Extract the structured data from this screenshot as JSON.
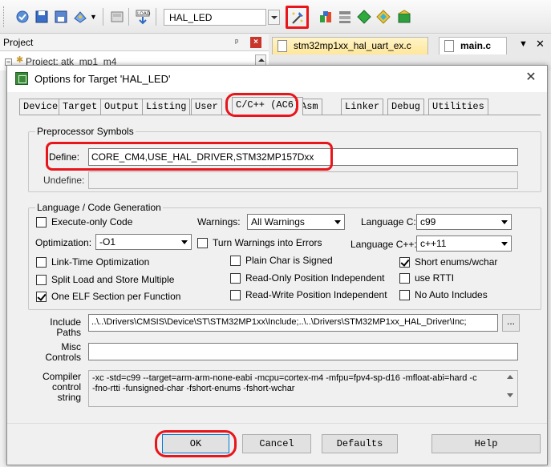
{
  "toolbar": {
    "target_name": "HAL_LED",
    "icons": [
      "build-icon",
      "save-all-icon",
      "copy-icon",
      "batch-build-icon",
      "dropdown-icon",
      "disk-icon",
      "load-icon",
      "options-for-target-icon",
      "manage-components-icon",
      "pack-installer-icon",
      "select-packs-icon",
      "run-icon"
    ]
  },
  "project_panel": {
    "title": "Project",
    "root": "Project: atk_mp1_m4"
  },
  "editor_tabs": [
    {
      "label": "stm32mp1xx_hal_uart_ex.c"
    },
    {
      "label": "main.c"
    }
  ],
  "dialog": {
    "title": "Options for Target 'HAL_LED'",
    "tabs": [
      "Device",
      "Target",
      "Output",
      "Listing",
      "User",
      "C/C++ (AC6)",
      "Asm",
      "Linker",
      "Debug",
      "Utilities"
    ],
    "active_tab": "C/C++ (AC6)",
    "preprocessor": {
      "group_label": "Preprocessor Symbols",
      "define_label": "Define:",
      "define_value": "CORE_CM4,USE_HAL_DRIVER,STM32MP157Dxx",
      "undefine_label": "Undefine:",
      "undefine_value": ""
    },
    "language": {
      "group_label": "Language / Code Generation",
      "execute_only": "Execute-only Code",
      "warnings_label": "Warnings:",
      "warnings_value": "All Warnings",
      "language_c_label": "Language C:",
      "language_c_value": "c99",
      "optimization_label": "Optimization:",
      "optimization_value": "-O1",
      "turn_warnings": "Turn Warnings into Errors",
      "language_cpp_label": "Language C++:",
      "language_cpp_value": "c++11",
      "lto": "Link-Time Optimization",
      "plain_char": "Plain Char is Signed",
      "short_enums": "Short enums/wchar",
      "split_load": "Split Load and Store Multiple",
      "ropi": "Read-Only Position Independent",
      "use_rtti": "use RTTI",
      "one_elf": "One ELF Section per Function",
      "rwpi": "Read-Write Position Independent",
      "no_auto": "No Auto Includes"
    },
    "include_paths": {
      "label_1": "Include",
      "label_2": "Paths",
      "value": "..\\..\\Drivers\\CMSIS\\Device\\ST\\STM32MP1xx\\Include;..\\..\\Drivers\\STM32MP1xx_HAL_Driver\\Inc;",
      "browse": "..."
    },
    "misc_controls": {
      "label_1": "Misc",
      "label_2": "Controls",
      "value": ""
    },
    "compiler_string": {
      "label_1": "Compiler",
      "label_2": "control",
      "label_3": "string",
      "line_1": "-xc -std=c99 --target=arm-arm-none-eabi -mcpu=cortex-m4 -mfpu=fpv4-sp-d16 -mfloat-abi=hard -c",
      "line_2": "-fno-rtti -funsigned-char -fshort-enums -fshort-wchar"
    },
    "buttons": {
      "ok": "OK",
      "cancel": "Cancel",
      "defaults": "Defaults",
      "help": "Help"
    }
  },
  "colors": {
    "highlight": "#e8151b",
    "dialog_bg": "#f0f0f0"
  }
}
